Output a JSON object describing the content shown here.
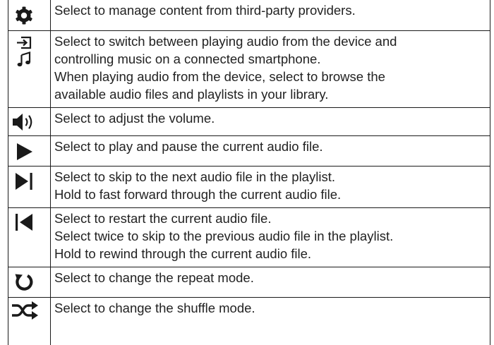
{
  "rows": [
    {
      "icon": "gear-icon",
      "lines": [
        "Select to manage content from third-party providers."
      ]
    },
    {
      "icon": "source-switch-music-note-icon",
      "lines": [
        "Select to switch between playing audio from the device and",
        "controlling music on a connected smartphone.",
        "When playing audio from the device, select to browse the",
        "available audio files and playlists in your library."
      ]
    },
    {
      "icon": "volume-icon",
      "lines": [
        "Select to adjust the volume."
      ]
    },
    {
      "icon": "play-icon",
      "lines": [
        "Select to play and pause the current audio file."
      ]
    },
    {
      "icon": "skip-next-icon",
      "lines": [
        "Select to skip to the next audio file in the playlist.",
        "Hold to fast forward through the current audio file."
      ]
    },
    {
      "icon": "skip-previous-icon",
      "lines": [
        "Select to restart the current audio file.",
        "Select twice to skip to the previous audio file in the playlist.",
        "Hold to rewind through the current audio file."
      ]
    },
    {
      "icon": "repeat-icon",
      "lines": [
        "Select to change the repeat mode."
      ]
    },
    {
      "icon": "shuffle-icon",
      "lines": [
        "Select to change the shuffle mode."
      ]
    }
  ]
}
